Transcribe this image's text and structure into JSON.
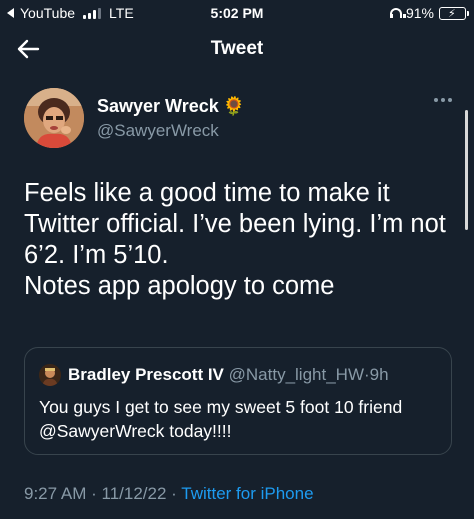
{
  "status_bar": {
    "back_app": "YouTube",
    "carrier": "LTE",
    "time": "5:02 PM",
    "battery": "91%",
    "battery_level": 0.91,
    "battery_color": "#3ec54a"
  },
  "nav": {
    "title": "Tweet"
  },
  "author": {
    "name": "Sawyer Wreck",
    "badge": "🌻",
    "handle": "@SawyerWreck"
  },
  "tweet": {
    "text": "Feels like a good time to make it Twitter official. I’ve been lying. I’m not 6’2. I’m 5’10.\nNotes app apology to come"
  },
  "quoted": {
    "name": "Bradley Prescott IV",
    "handle": "@Natty_light_HW",
    "separator": "·",
    "age": "9h",
    "text": "You guys I get to see my sweet 5 foot 10 friend @SawyerWreck today!!!!"
  },
  "meta": {
    "time": "9:27 AM",
    "separator": "·",
    "date": "11/12/22",
    "separator2": "·",
    "source": "Twitter for iPhone"
  },
  "colors": {
    "background": "#16202c",
    "secondary_text": "#8899a6",
    "link": "#1d9bf0",
    "border": "#38444d"
  }
}
